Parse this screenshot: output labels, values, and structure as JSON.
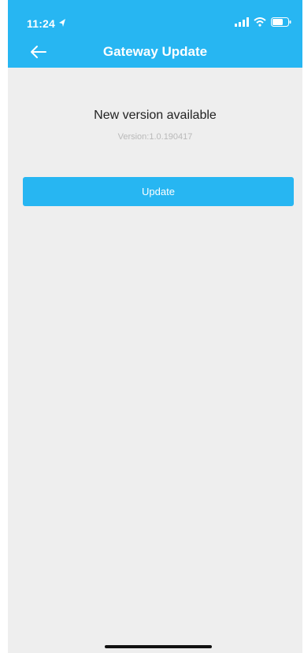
{
  "status_bar": {
    "time": "11:24",
    "icons": [
      "location-arrow-icon",
      "signal-icon",
      "wifi-icon",
      "battery-icon"
    ]
  },
  "nav": {
    "title": "Gateway Update",
    "back_icon": "arrow-left-icon"
  },
  "main": {
    "headline": "New version available",
    "version": "Version:1.0.190417",
    "update_label": "Update"
  },
  "colors": {
    "accent": "#27b6f2",
    "background": "#eeeeee",
    "text": "#222222",
    "muted": "#b9b9b9"
  }
}
